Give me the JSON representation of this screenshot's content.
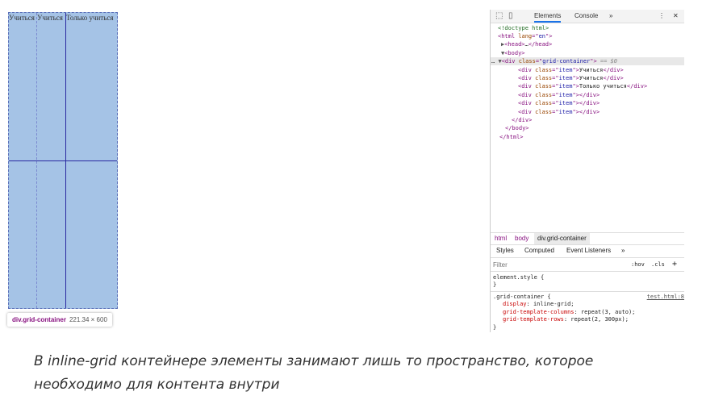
{
  "rendered_grid": {
    "item_texts": [
      "Учиться",
      "Учиться",
      "Только учиться"
    ],
    "tooltip_tag": "div.grid-container",
    "tooltip_size": "221.34 × 600"
  },
  "devtools": {
    "toolbar": {
      "tab_elements": "Elements",
      "tab_console": "Console",
      "more": "»",
      "menu": "⋮",
      "close": "✕"
    },
    "dom_lines": [
      {
        "k": "comment",
        "text": "<!doctype html>"
      },
      {
        "k": "open",
        "tag": "html",
        "attr": "lang",
        "val": "en"
      },
      {
        "k": "collapsed",
        "tag": "head",
        "ell": "…"
      },
      {
        "k": "open",
        "tag": "body"
      },
      {
        "k": "selected",
        "tag": "div",
        "attr": "class",
        "val": "grid-container",
        "suffix": " == $0"
      },
      {
        "k": "child",
        "tag": "div",
        "attr": "class",
        "val": "item",
        "text": "Учиться"
      },
      {
        "k": "child",
        "tag": "div",
        "attr": "class",
        "val": "item",
        "text": "Учиться"
      },
      {
        "k": "child",
        "tag": "div",
        "attr": "class",
        "val": "item",
        "text": "Только учиться"
      },
      {
        "k": "child",
        "tag": "div",
        "attr": "class",
        "val": "item",
        "text": ""
      },
      {
        "k": "child",
        "tag": "div",
        "attr": "class",
        "val": "item",
        "text": ""
      },
      {
        "k": "child",
        "tag": "div",
        "attr": "class",
        "val": "item",
        "text": ""
      },
      {
        "k": "close",
        "tag": "div"
      },
      {
        "k": "close",
        "tag": "body"
      },
      {
        "k": "close",
        "tag": "html"
      }
    ],
    "breadcrumb": [
      "html",
      "body",
      "div.grid-container"
    ],
    "styles_tabs": [
      "Styles",
      "Computed",
      "Event Listeners",
      "»"
    ],
    "filter_placeholder": "Filter",
    "filter_buttons": [
      ":hov",
      ".cls",
      "+"
    ],
    "element_style": {
      "selector": "element.style {",
      "close": "}"
    },
    "rule": {
      "selector": ".grid-container {",
      "source": "test.html:8",
      "declarations": [
        {
          "prop": "display",
          "value": "inline-grid;"
        },
        {
          "prop": "grid-template-columns",
          "value": "repeat(3, auto);"
        },
        {
          "prop": "grid-template-rows",
          "value": "repeat(2, 300px);"
        }
      ],
      "close": "}"
    }
  },
  "caption": "В inline-grid контейнере элементы занимают лишь то пространство, которое необходимо для контента внутри"
}
